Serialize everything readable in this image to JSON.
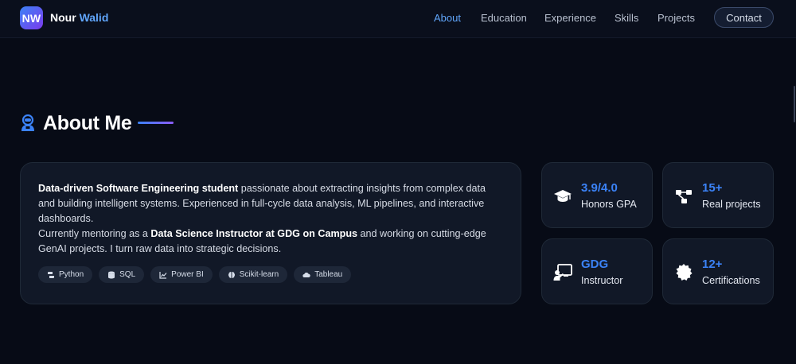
{
  "nav": {
    "logo": "NW",
    "brand_first": "Nour",
    "brand_last": "Walid",
    "links": [
      "About",
      "Education",
      "Experience",
      "Skills",
      "Projects"
    ],
    "contact": "Contact"
  },
  "about": {
    "title": "About Me",
    "bio": {
      "lead": "Data-driven Software Engineering student",
      "text1": " passionate about extracting insights from complex data and building intelligent systems. Experienced in full-cycle data analysis, ML pipelines, and interactive dashboards.",
      "text2_pre": "Currently mentoring as a ",
      "role": "Data Science Instructor at GDG on Campus",
      "text2_post": " and working on cutting-edge GenAI projects. I turn raw data into strategic decisions."
    },
    "tags": [
      {
        "label": "Python",
        "icon": "python-icon"
      },
      {
        "label": "SQL",
        "icon": "database-icon"
      },
      {
        "label": "Power BI",
        "icon": "chart-line-icon"
      },
      {
        "label": "Scikit-learn",
        "icon": "brain-icon"
      },
      {
        "label": "Tableau",
        "icon": "cloud-icon"
      }
    ]
  },
  "stats": [
    {
      "value": "3.9/4.0",
      "label": "Honors GPA",
      "icon": "graduation-cap-icon"
    },
    {
      "value": "15+",
      "label": "Real projects",
      "icon": "diagram-icon"
    },
    {
      "value": "GDG",
      "label": "Instructor",
      "icon": "teacher-icon"
    },
    {
      "value": "12+",
      "label": "Certifications",
      "icon": "certificate-icon"
    }
  ],
  "colors": {
    "accent": "#3b82f6",
    "accent_light": "#60a5fa",
    "purple": "#7c3aed",
    "background": "#070b16",
    "card": "#111827"
  }
}
